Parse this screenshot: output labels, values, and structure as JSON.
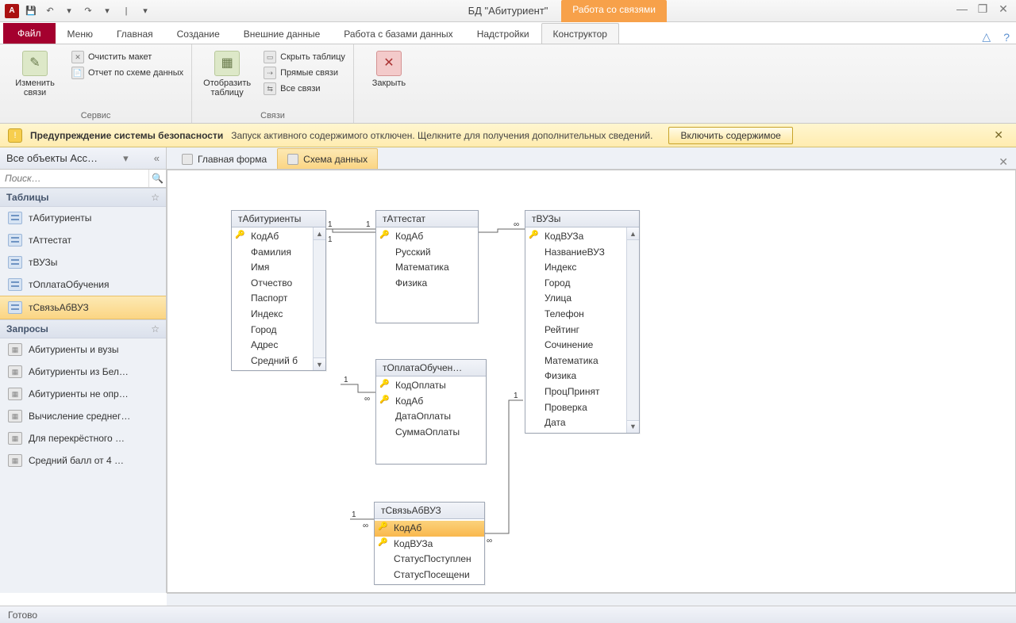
{
  "app": {
    "title": "БД \"Абитуриент\"",
    "context_tab": "Работа со связями",
    "logo": "A"
  },
  "qat": {
    "save": "💾",
    "undo": "↶",
    "redo": "↷",
    "dd": "▾",
    "sep": "|"
  },
  "win": {
    "min": "—",
    "max": "❐",
    "close": "✕"
  },
  "tabs": {
    "file": "Файл",
    "menu": "Меню",
    "home": "Главная",
    "create": "Создание",
    "external": "Внешние данные",
    "dbtools": "Работа с базами данных",
    "addons": "Надстройки",
    "constructor": "Конструктор"
  },
  "ribbon": {
    "g1": {
      "label": "Сервис",
      "edit": "Изменить связи",
      "clear": "Очистить макет",
      "report": "Отчет по схеме данных"
    },
    "g2": {
      "label": "Связи",
      "show": "Отобразить таблицу",
      "hide": "Скрыть таблицу",
      "direct": "Прямые связи",
      "all": "Все связи"
    },
    "g3": {
      "close": "Закрыть"
    }
  },
  "security": {
    "title": "Предупреждение системы безопасности",
    "msg": "Запуск активного содержимого отключен. Щелкните для получения дополнительных сведений.",
    "enable": "Включить содержимое"
  },
  "sidebar": {
    "header": "Все объекты Acc…",
    "collapse": "«",
    "dd": "▾",
    "search_ph": "Поиск…",
    "cat_tables": "Таблицы",
    "tables": [
      "тАбитуриенты",
      "тАттестат",
      "тВУЗы",
      "тОплатаОбучения",
      "тСвязьАбВУЗ"
    ],
    "cat_queries": "Запросы",
    "queries": [
      "Абитуриенты и вузы",
      "Абитуриенты из Бел…",
      "Абитуриенты не опр…",
      "Вычисление среднег…",
      "Для перекрёстного …",
      "Средний балл от 4 …"
    ],
    "rollup": "☆"
  },
  "doctabs": {
    "t1": "Главная форма",
    "t2": "Схема данных"
  },
  "tables": {
    "abit": {
      "title": "тАбитуриенты",
      "fields": [
        "КодАб",
        "Фамилия",
        "Имя",
        "Отчество",
        "Паспорт",
        "Индекс",
        "Город",
        "Адрес",
        "Средний б"
      ]
    },
    "att": {
      "title": "тАттестат",
      "fields": [
        "КодАб",
        "Русский",
        "Математика",
        "Физика"
      ]
    },
    "vuz": {
      "title": "тВУЗы",
      "fields": [
        "КодВУЗа",
        "НазваниеВУЗ",
        "Индекс",
        "Город",
        "Улица",
        "Телефон",
        "Рейтинг",
        "Сочинение",
        "Математика",
        "Физика",
        "ПроцПринят",
        "Проверка",
        "Дата"
      ]
    },
    "opl": {
      "title": "тОплатаОбучен…",
      "fields": [
        "КодОплаты",
        "КодАб",
        "ДатаОплаты",
        "СуммаОплаты"
      ]
    },
    "link": {
      "title": "тСвязьАбВУЗ",
      "fields": [
        "КодАб",
        "КодВУЗа",
        "СтатусПоступлен",
        "СтатусПосещени"
      ]
    }
  },
  "rel": {
    "one": "1",
    "inf": "∞"
  },
  "status": "Готово"
}
